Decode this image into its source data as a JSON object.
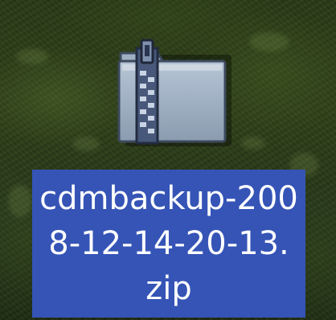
{
  "desktop": {
    "selected_file": {
      "name_lines": [
        "cdmbackup-200",
        "8-12-14-20-13.",
        "zip"
      ],
      "icon": "zip-folder-icon",
      "selection_color": "#3554b6"
    }
  }
}
